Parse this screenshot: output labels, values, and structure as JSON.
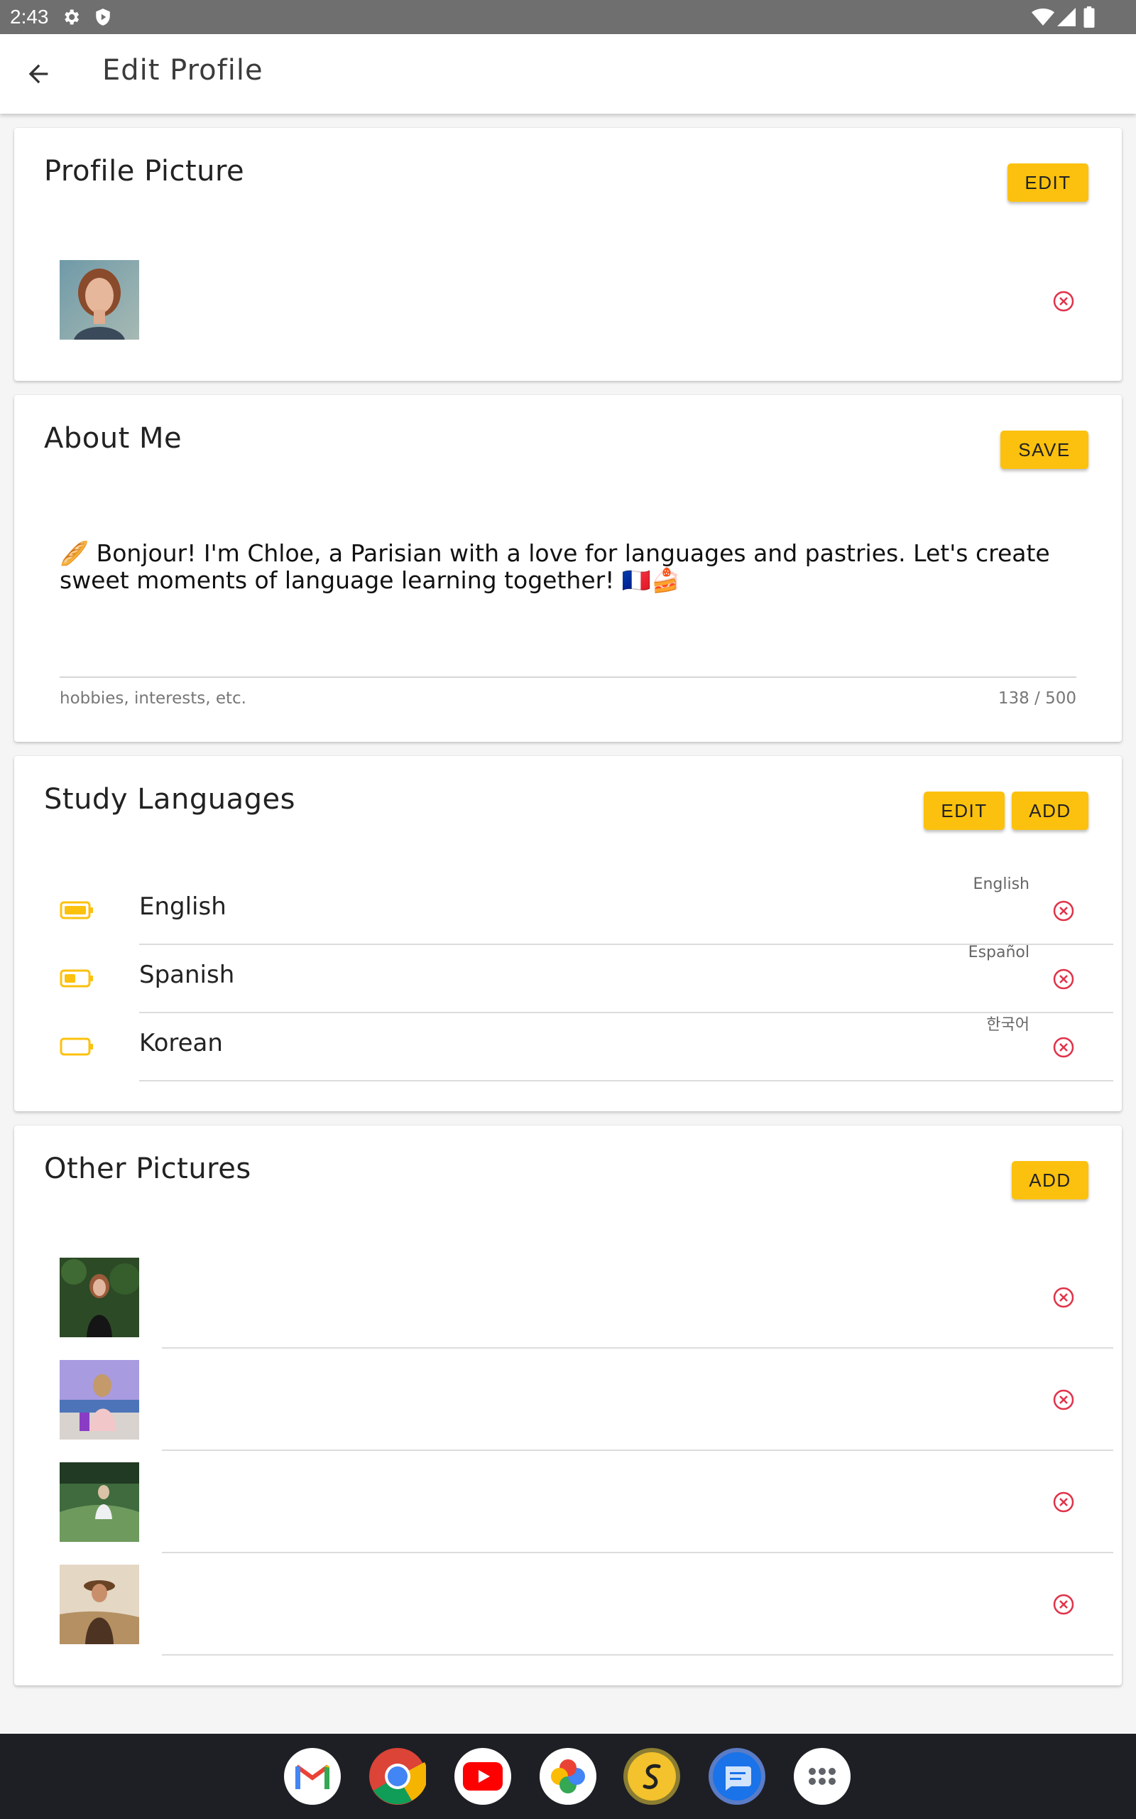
{
  "status_bar": {
    "time": "2:43"
  },
  "app_bar": {
    "title": "Edit Profile",
    "back_icon": "arrow-left-icon"
  },
  "profile_picture": {
    "title": "Profile Picture",
    "edit_label": "EDIT"
  },
  "about_me": {
    "title": "About Me",
    "save_label": "SAVE",
    "text": "🥖 Bonjour! I'm Chloe, a Parisian with a love for languages and pastries. Let's create sweet moments of language learning together! 🇫🇷🍰",
    "hint": "hobbies, interests, etc.",
    "counter": "138 / 500"
  },
  "study_languages": {
    "title": "Study Languages",
    "edit_label": "EDIT",
    "add_label": "ADD",
    "items": [
      {
        "name": "English",
        "native": "English",
        "level": 1.0
      },
      {
        "name": "Spanish",
        "native": "Español",
        "level": 0.5
      },
      {
        "name": "Korean",
        "native": "한국어",
        "level": 0.0
      }
    ]
  },
  "other_pictures": {
    "title": "Other Pictures",
    "add_label": "ADD",
    "count": 4
  },
  "colors": {
    "accent": "#fcc10e",
    "remove": "#e0334a"
  },
  "dock": [
    "gmail-icon",
    "chrome-icon",
    "youtube-icon",
    "photos-icon",
    "app-s-icon",
    "messages-icon",
    "apps-icon"
  ]
}
